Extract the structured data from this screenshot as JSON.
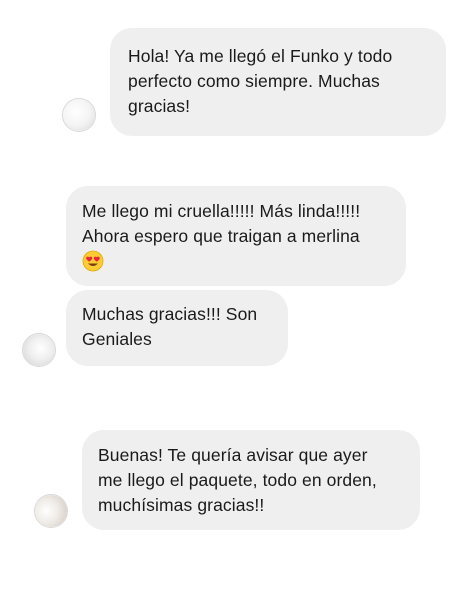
{
  "messages": [
    {
      "id": "msg1",
      "lines": [
        "Hola! Ya me llegó el Funko y todo",
        "perfecto como siempre. Muchas",
        "gracias!"
      ]
    },
    {
      "id": "msg2",
      "lines": [
        "Me llego mi cruella!!!!! Más linda!!!!!",
        "Ahora espero que traigan a merlina"
      ],
      "trailing_emoji": "heart-eyes-emoji"
    },
    {
      "id": "msg3",
      "lines": [
        "Muchas gracias!!! Son",
        "Geniales"
      ]
    },
    {
      "id": "msg4",
      "lines": [
        "Buenas! Te quería avisar que ayer",
        "me llego el paquete, todo en orden,",
        "muchísimas gracias!!"
      ]
    }
  ],
  "colors": {
    "bubble": "#efefef",
    "text": "#1a1a1a",
    "emoji_face": "#ffcc33",
    "emoji_heart": "#e8253c"
  }
}
